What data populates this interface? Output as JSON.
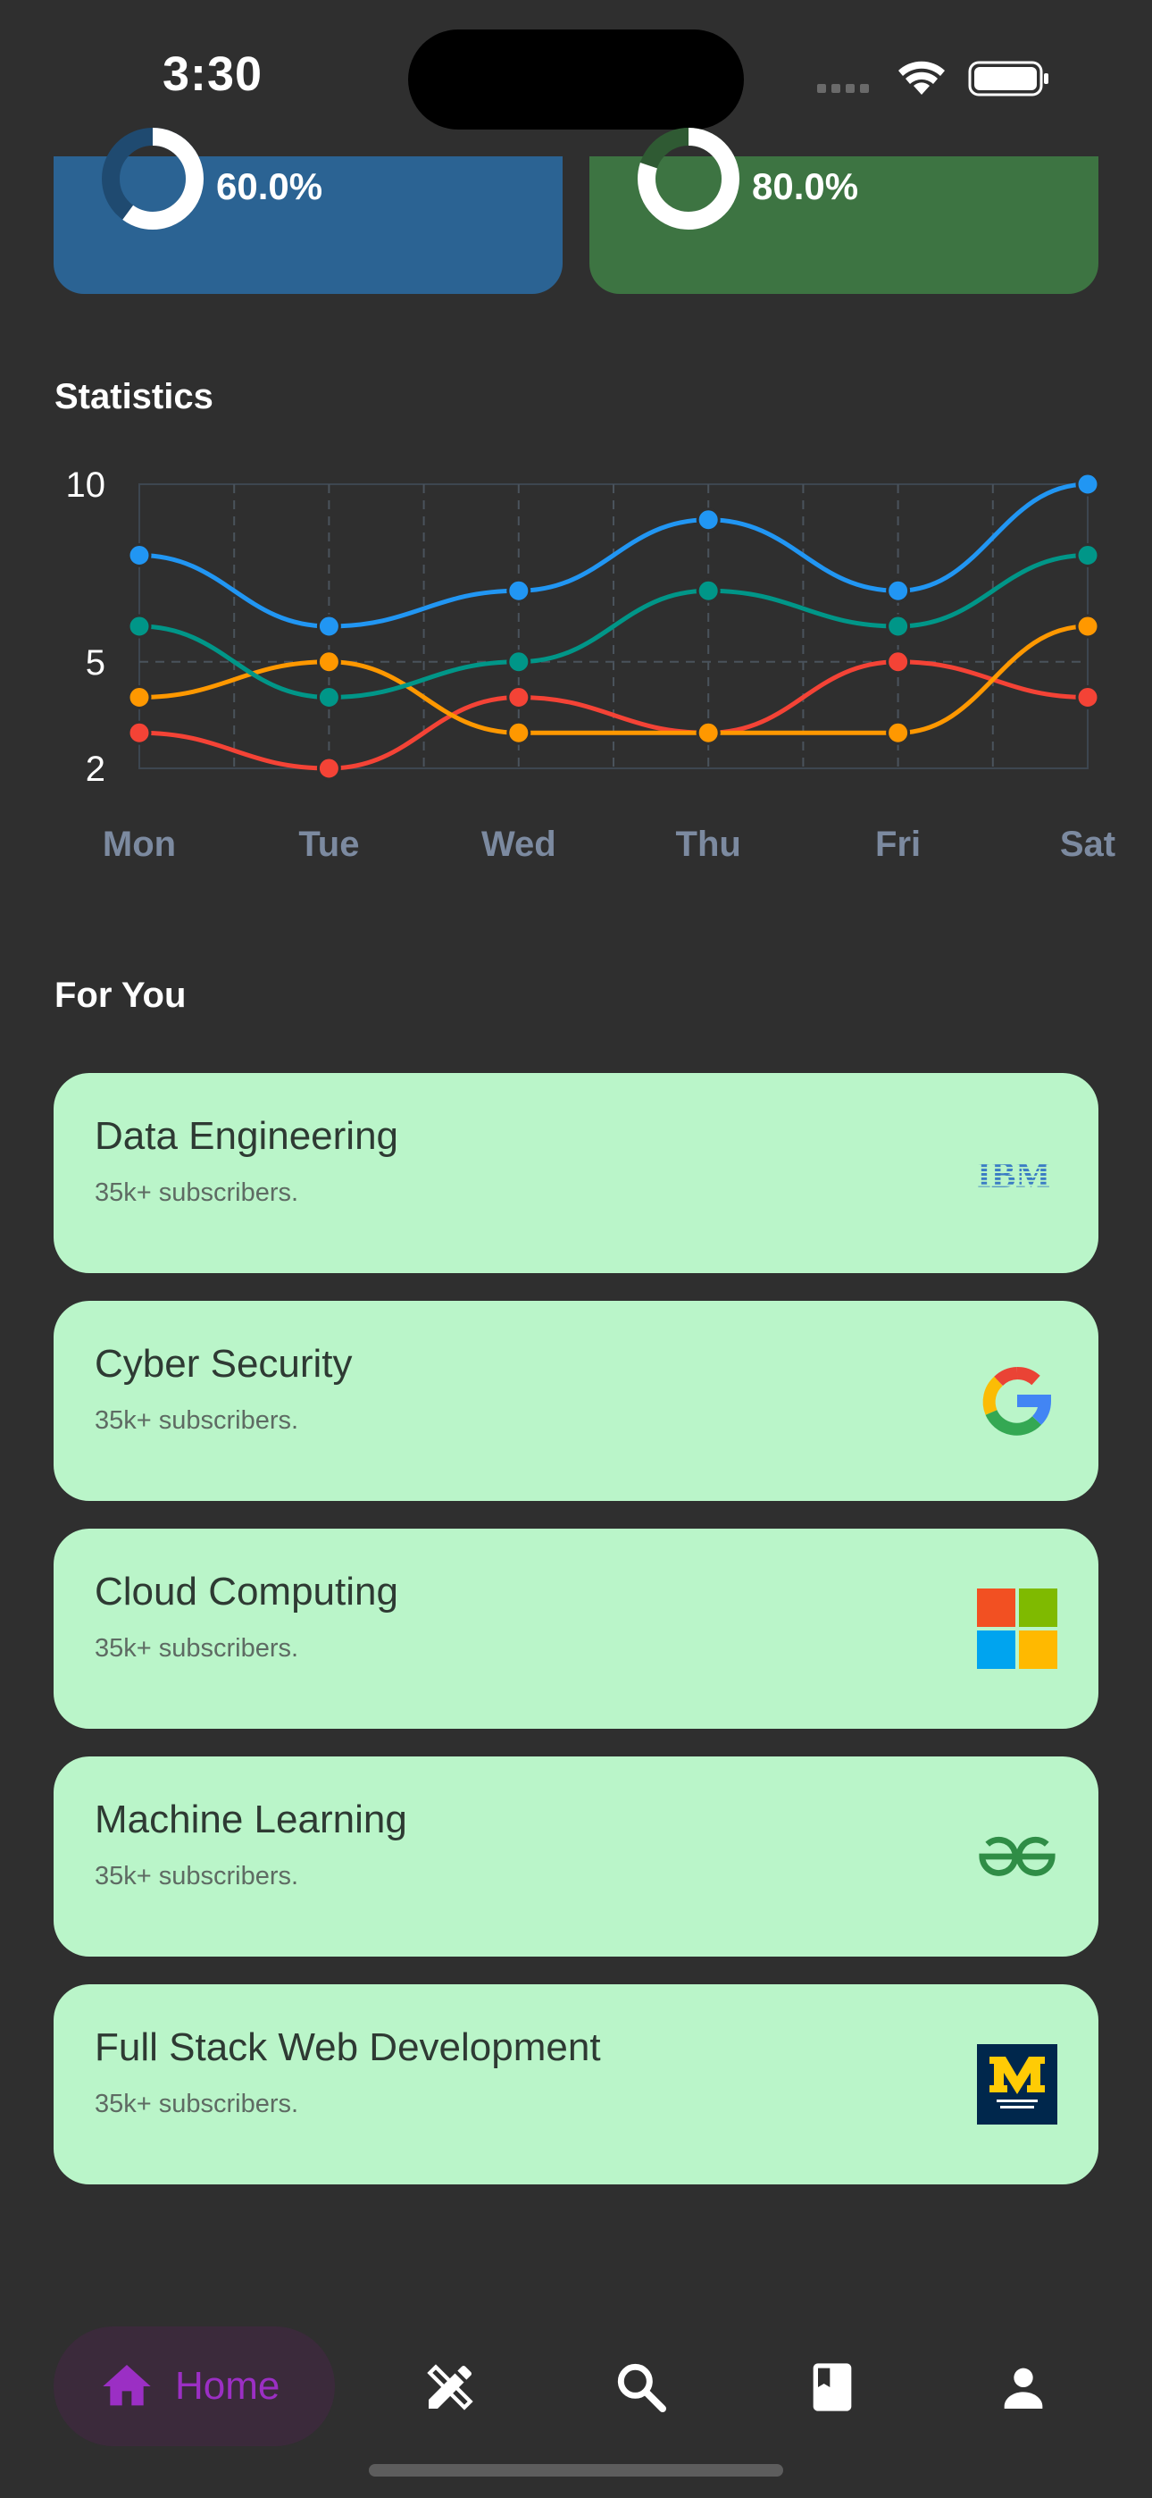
{
  "status_bar": {
    "time": "3:30"
  },
  "progress_cards": [
    {
      "value": "60.0%",
      "fraction": 0.6,
      "color": "#2b6393",
      "ring_color": "#ffffff",
      "ring_track": "#1f4a70"
    },
    {
      "value": "80.0%",
      "fraction": 0.8,
      "color": "#3d7442",
      "ring_color": "#ffffff",
      "ring_track": "#2f5a33"
    }
  ],
  "statistics": {
    "title": "Statistics"
  },
  "chart_data": {
    "type": "line",
    "categories": [
      "Mon",
      "Tue",
      "Wed",
      "Thu",
      "Fri",
      "Sat"
    ],
    "y_ticks": [
      "10",
      "5",
      "2"
    ],
    "ylim": [
      2,
      10
    ],
    "grid": true,
    "series": [
      {
        "color": "#2196f3",
        "values": [
          8,
          6,
          7,
          9,
          7,
          10
        ]
      },
      {
        "color": "#009688",
        "values": [
          6,
          4,
          5,
          7,
          6,
          8
        ]
      },
      {
        "color": "#ff9800",
        "values": [
          4,
          5,
          3,
          3,
          3,
          6
        ]
      },
      {
        "color": "#f44336",
        "values": [
          3,
          2,
          4,
          3,
          5,
          4
        ]
      }
    ]
  },
  "for_you": {
    "title": "For You",
    "courses": [
      {
        "title": "Data Engineering",
        "subtitle": "35k+ subscribers.",
        "logo": "ibm-logo"
      },
      {
        "title": "Cyber Security",
        "subtitle": "35k+ subscribers.",
        "logo": "google-logo"
      },
      {
        "title": "Cloud Computing",
        "subtitle": "35k+ subscribers.",
        "logo": "microsoft-logo"
      },
      {
        "title": "Machine Learning",
        "subtitle": "35k+ subscribers.",
        "logo": "geeksforgeeks-logo"
      },
      {
        "title": "Full Stack Web Development",
        "subtitle": "35k+ subscribers.",
        "logo": "umich-logo"
      }
    ]
  },
  "bottom_nav": {
    "home_label": "Home",
    "active_color": "#9b2fc4",
    "items": [
      "home-icon",
      "design-tools-icon",
      "search-icon",
      "bookmark-book-icon",
      "profile-icon"
    ]
  }
}
